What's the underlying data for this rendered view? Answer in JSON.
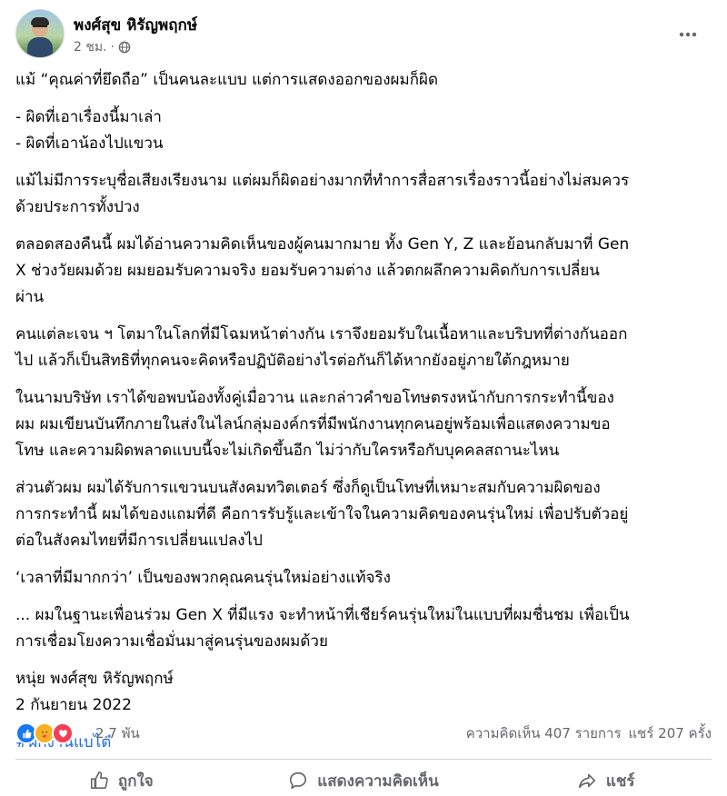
{
  "post": {
    "author": "พงศ์สุข หิรัญพฤกษ์",
    "time": "2 ชม.",
    "separator": "·",
    "paragraphs": [
      [
        "แม้ “คุณค่าที่ยึดถือ” เป็นคนละแบบ  แต่การแสดงออกของผมก็ผิด"
      ],
      [
        "- ผิดที่เอาเรื่องนี้มาเล่า",
        "- ผิดที่เอาน้องไปแขวน"
      ],
      [
        "แม้ไม่มีการระบุชื่อเสียงเรียงนาม แต่ผมก็ผิดอย่างมากที่ทำการสื่อสารเรื่องราวนี้อย่างไม่สมควร",
        "ด้วยประการทั้งปวง"
      ],
      [
        "ตลอดสองคืนนี้ ผมได้อ่านความคิดเห็นของผู้คนมากมาย ทั้ง Gen Y, Z และย้อนกลับมาที่ Gen",
        "X ช่วงวัยผมด้วย  ผมยอมรับความจริง ยอมรับความต่าง แล้วตกผลึกความคิดกับการเปลี่ยน",
        "ผ่าน"
      ],
      [
        "คนแต่ละเจน ฯ โตมาในโลกที่มีโฉมหน้าต่างกัน เราจึงยอมรับในเนื้อหาและบริบทที่ต่างกันออก",
        "ไป แล้วก็เป็นสิทธิที่ทุกคนจะคิดหรือปฏิบัติอย่างไรต่อกันก็ได้หากยังอยู่ภายใต้กฎหมาย"
      ],
      [
        "ในนามบริษัท เราได้ขอพบน้องทั้งคู่เมื่อวาน และกล่าวคำขอโทษตรงหน้ากับการกระทำนี้ของ",
        "ผม ผมเขียนบันทึกภายในส่งในไลน์กลุ่มองค์กรที่มีพนักงานทุกคนอยู่พร้อมเพื่อแสดงความขอ",
        "โทษ และความผิดพลาดแบบนี้จะไม่เกิดขึ้นอีก ไม่ว่ากับใครหรือกับบุคคลสถานะไหน"
      ],
      [
        "ส่วนตัวผม ผมได้รับการแขวนบนสังคมทวิตเตอร์ ซึ่งก็ดูเป็นโทษที่เหมาะสมกับความผิดของ",
        "การกระทำนี้  ผมได้ของแถมที่ดี คือการรับรู้และเข้าใจในความคิดของคนรุ่นใหม่ เพื่อปรับตัวอยู่",
        "ต่อในสังคมไทยที่มีการเปลี่ยนแปลงไป"
      ],
      [
        "‘เวลาที่มีมากกว่า’ เป็นของพวกคุณคนรุ่นใหม่อย่างแท้จริง"
      ],
      [
        "... ผมในฐานะเพื่อนร่วม Gen X ที่มีแรง จะทำหน้าที่เชียร์คนรุ่นใหม่ในแบบที่ผมชื่นชม เพื่อเป็น",
        "การเชื่อมโยงความเชื่อมั่นมาสู่คนรุ่นของผมด้วย"
      ],
      [
        "หนุ่ย พงศ์สุข หิรัญพฤกษ์",
        "2 กันยายน 2022"
      ]
    ],
    "hashtag": "#ฝึกงานแบไต๋"
  },
  "stats": {
    "reactions": "2.7 พัน",
    "comments": "ความคิดเห็น 407 รายการ",
    "shares": "แชร์ 207 ครั้ง"
  },
  "actions": {
    "like": "ถูกใจ",
    "comment": "แสดงความคิดเห็น",
    "share": "แชร์"
  },
  "icons": {
    "privacy": "globe-icon",
    "menu": "more-options-icon",
    "reactions": [
      "like-reaction-icon",
      "care-reaction-icon",
      "love-reaction-icon"
    ]
  },
  "colors": {
    "text": "#050505",
    "secondary": "#65676b",
    "link": "#216fdb",
    "like": "#1877f2",
    "love": "#f33e58",
    "care": "#f7b125"
  }
}
